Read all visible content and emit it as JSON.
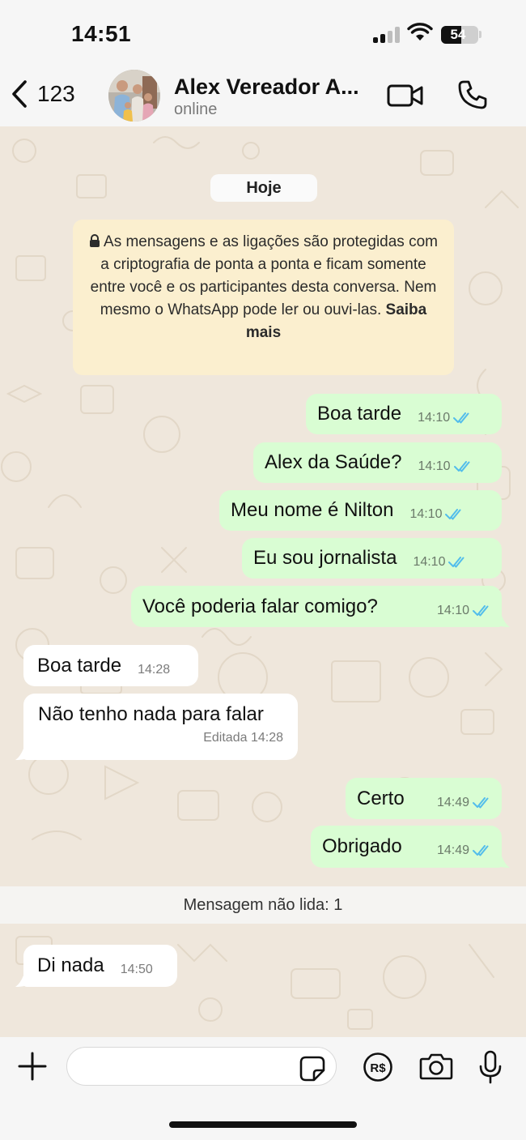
{
  "status_bar": {
    "time": "14:51",
    "battery": "54",
    "battery_level": 0.54
  },
  "header": {
    "back_count": "123",
    "contact_name": "Alex Vereador A...",
    "contact_status": "online",
    "icons": [
      "chevron-left-icon",
      "video-call-icon",
      "phone-icon"
    ]
  },
  "chat": {
    "day_label": "Hoje",
    "e2e_notice": "As mensagens e as ligações são protegidas com a criptografia de ponta a ponta e ficam somente entre você e os participantes desta conversa. Nem mesmo o WhatsApp pode ler ou ouvi-las.",
    "e2e_link": "Saiba mais",
    "messages": [
      {
        "direction": "out",
        "text": "Boa tarde",
        "time": "14:10",
        "status": "read"
      },
      {
        "direction": "out",
        "text": "Alex da Saúde?",
        "time": "14:10",
        "status": "read"
      },
      {
        "direction": "out",
        "text": "Meu nome é Nilton",
        "time": "14:10",
        "status": "read"
      },
      {
        "direction": "out",
        "text": "Eu sou jornalista",
        "time": "14:10",
        "status": "read"
      },
      {
        "direction": "out",
        "text": "Você poderia falar comigo?",
        "time": "14:10",
        "status": "read"
      },
      {
        "direction": "in",
        "text": "Boa tarde",
        "time": "14:28"
      },
      {
        "direction": "in",
        "text": "Não tenho nada para falar",
        "edited_label": "Editada",
        "time": "14:28"
      },
      {
        "direction": "out",
        "text": "Certo",
        "time": "14:49",
        "status": "read"
      },
      {
        "direction": "out",
        "text": "Obrigado",
        "time": "14:49",
        "status": "read"
      },
      {
        "direction": "in",
        "text": "Di nada",
        "time": "14:50"
      }
    ],
    "unread_label": "Mensagem não lida: 1",
    "colors": {
      "outgoing": "#d9fdd3",
      "incoming": "#ffffff",
      "read_tick": "#53bdeb",
      "wallpaper": "#efe7dc"
    }
  },
  "input_bar": {
    "placeholder": "",
    "icons": [
      "plus-icon",
      "sticker-icon",
      "payment-icon",
      "camera-icon",
      "microphone-icon"
    ]
  }
}
